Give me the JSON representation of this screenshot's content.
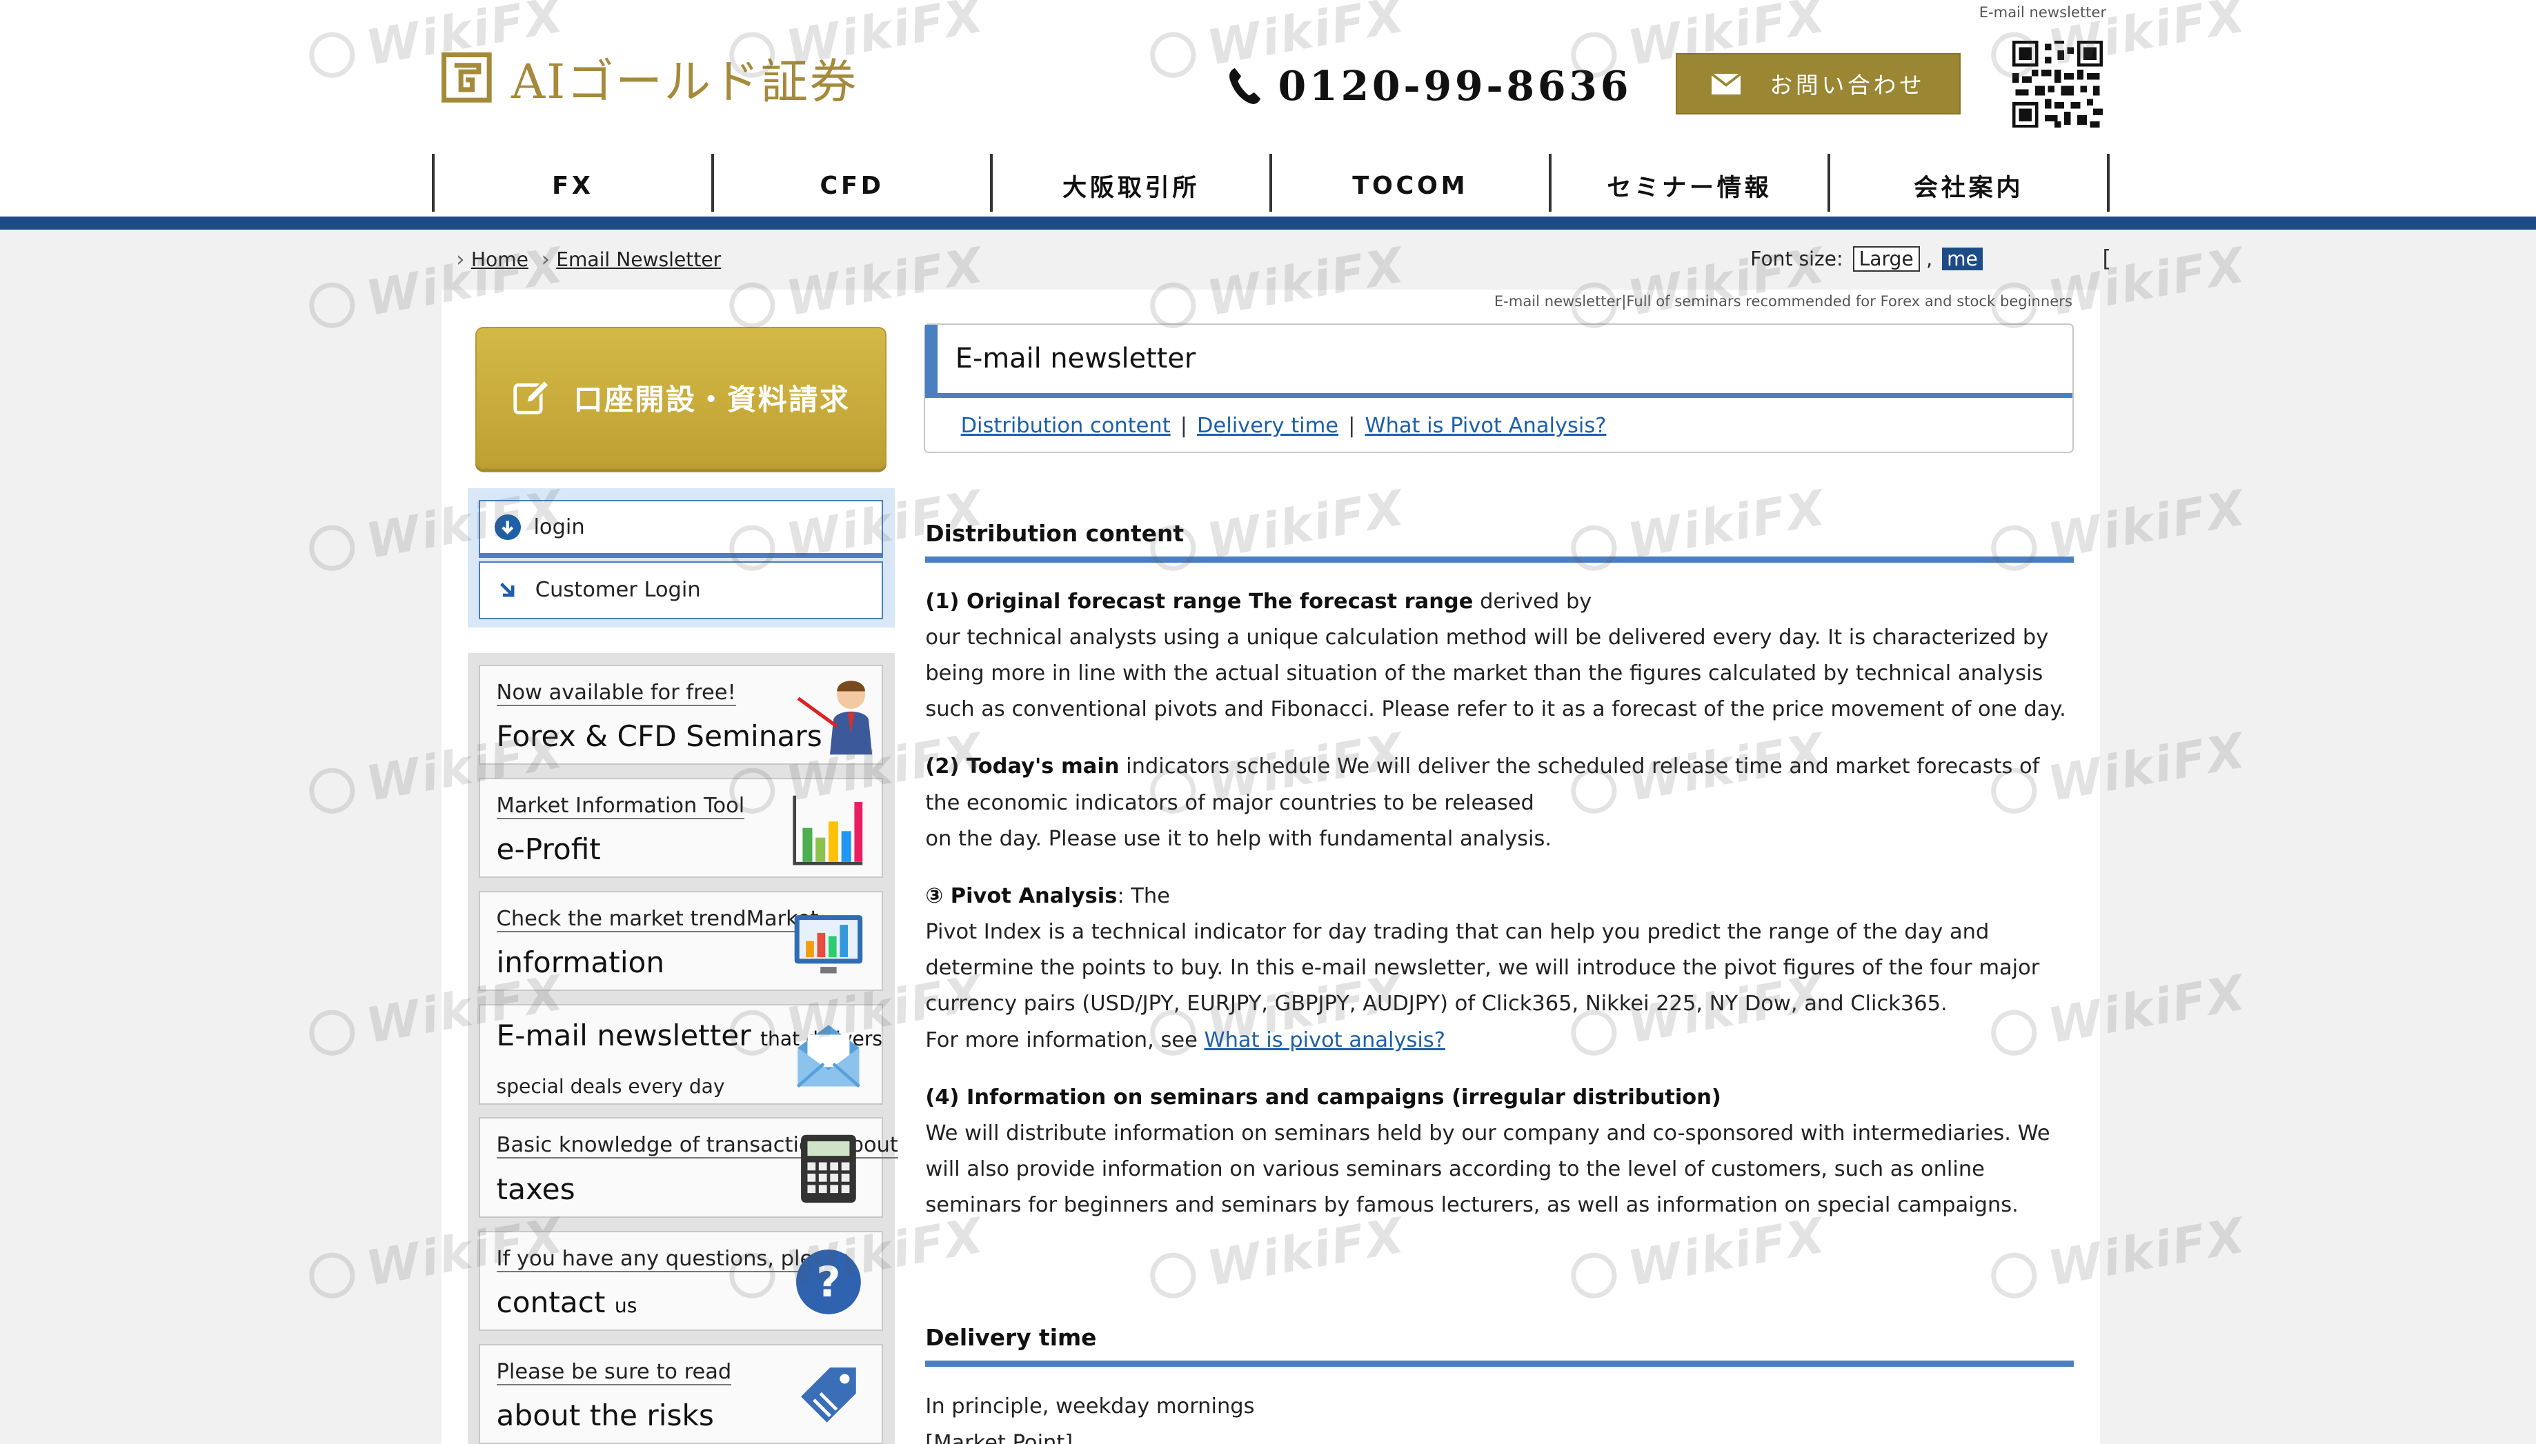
{
  "header": {
    "logo_text": "AIゴールド証券",
    "phone": "0120-99-8636",
    "contact_button": "お問い合わせ",
    "qr_label": "E-mail newsletter"
  },
  "nav": {
    "items": [
      "FX",
      "CFD",
      "大阪取引所",
      "TOCOM",
      "セミナー情報",
      "会社案内"
    ]
  },
  "breadcrumb": {
    "home": "Home",
    "current": "Email Newsletter"
  },
  "font_size": {
    "label": "Font size:",
    "large": "Large",
    "comma": ",",
    "medium": "me",
    "bracket": "["
  },
  "tagline": "E-mail newsletter|Full of seminars recommended for Forex and stock beginners",
  "sidebar": {
    "account_button": "口座開設・資料請求",
    "login_label": "login",
    "customer_login": "Customer Login",
    "items": [
      {
        "small": "Now available for free!",
        "big": "Forex & CFD Seminars"
      },
      {
        "small": "Market Information Tool",
        "big": "e-Profit"
      },
      {
        "small": "Check the market trendMarket",
        "big": "information"
      },
      {
        "big": "E-mail newsletter",
        "suffix": "that delivers",
        "sub": "special deals every day"
      },
      {
        "small": "Basic knowledge of transactionsAbout",
        "big": "taxes"
      },
      {
        "small": "If you have any questions, please",
        "big": "contact",
        "suffix": "us"
      },
      {
        "small": "Please be sure to read",
        "big": "about the risks"
      }
    ]
  },
  "main": {
    "title": "E-mail newsletter",
    "links": [
      "Distribution content",
      "Delivery time",
      "What is Pivot Analysis?"
    ],
    "section1": {
      "heading": "Distribution content",
      "p1_bold": "(1) Original forecast range The forecast range",
      "p1_rest": " derived by",
      "p1_body": "our technical analysts using a unique calculation method will be delivered every day. It is characterized by being more in line with the actual situation of the market than the figures calculated by technical analysis such as conventional pivots and Fibonacci. Please refer to it as a forecast of the price movement of one day.",
      "p2_bold": "(2) Today's main",
      "p2_rest": " indicators schedule We will deliver the scheduled release time and market forecasts of the economic indicators of major countries to be released",
      "p2_body": "on the day. Please use it to help with fundamental analysis.",
      "p3_bold": "③ Pivot Analysis",
      "p3_rest": ": The",
      "p3_body": "Pivot Index is a technical indicator for day trading that can help you predict the range of the day and determine the points to buy. In this e-mail newsletter, we will introduce the pivot figures of the four major currency pairs (USD/JPY, EURJPY, GBPJPY, AUDJPY) of Click365, Nikkei 225, NY Dow, and Click365.",
      "p3_more": "For more information, see ",
      "p3_link": "What is pivot analysis?",
      "p4_bold": "(4) Information on seminars and campaigns (irregular distribution)",
      "p4_body": "We will distribute information on seminars held by our company and co-sponsored with intermediaries. We will also provide information on various seminars according to the level of customers, such as online seminars for beginners and seminars by famous lecturers, as well as information on special campaigns."
    },
    "section2": {
      "heading": "Delivery time",
      "line1": "In principle, weekday mornings",
      "line2": "[Market Point]"
    }
  },
  "watermark": "WikiFX",
  "colors": {
    "gold": "#9a8633",
    "navy": "#1d4b86",
    "accent_blue": "#4a7fc1",
    "link": "#1d5fa8"
  }
}
